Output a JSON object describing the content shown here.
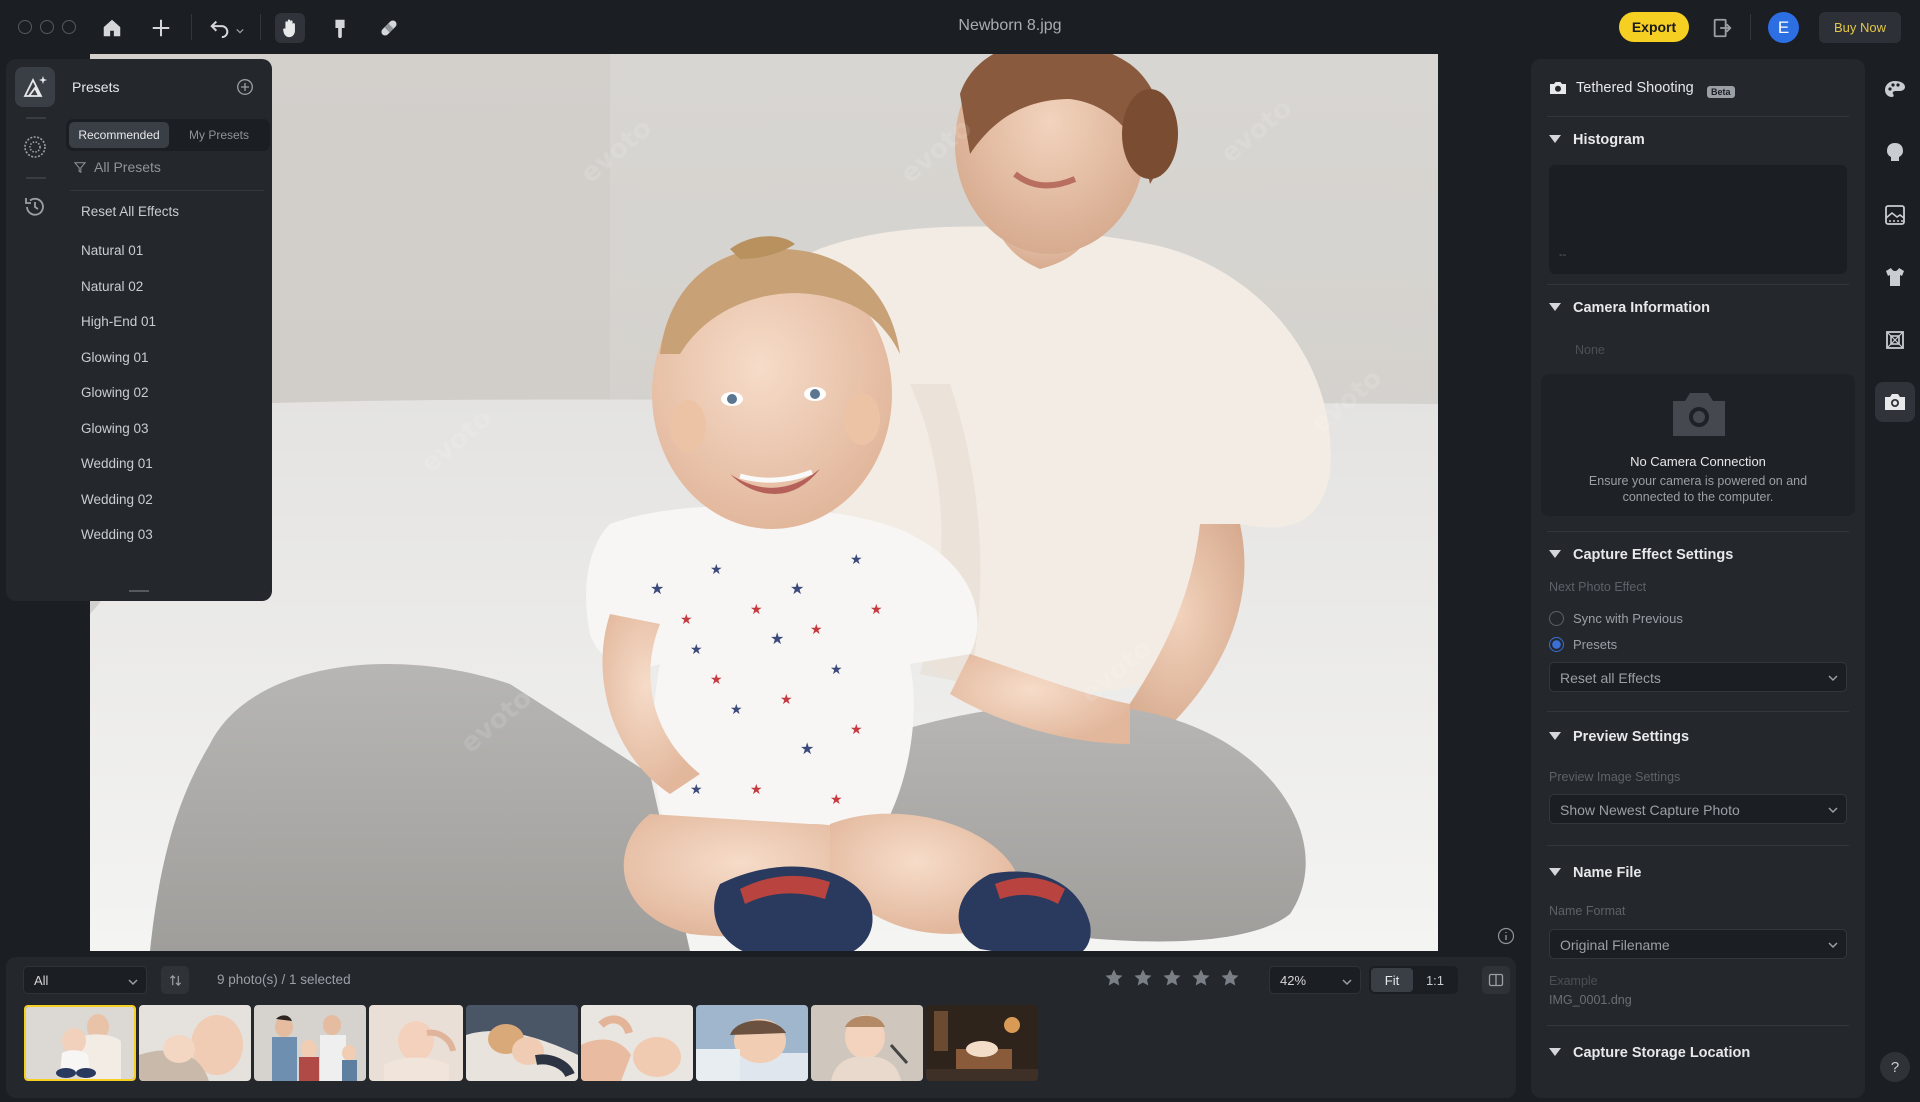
{
  "window": {
    "title": "Newborn 8.jpg"
  },
  "toolbar": {
    "icons": [
      "home-icon",
      "plus-icon",
      "undo-icon",
      "hand-icon",
      "brush-icon",
      "bandage-icon",
      "export-to-icon"
    ],
    "export_label": "Export",
    "user_initial": "E",
    "buy_label": "Buy Now"
  },
  "presets": {
    "title": "Presets",
    "tabs": [
      "Recommended",
      "My Presets"
    ],
    "filter_label": "All Presets",
    "items": [
      "Reset All Effects",
      "Natural 01",
      "Natural 02",
      "High-End 01",
      "Glowing 01",
      "Glowing 02",
      "Glowing 03",
      "Wedding 01",
      "Wedding 02",
      "Wedding 03"
    ]
  },
  "bottom": {
    "filter_value": "All",
    "count_text": "9 photo(s) / 1 selected",
    "zoom_value": "42%",
    "fit_label": "Fit",
    "one_to_one_label": "1:1",
    "star_rating": 0
  },
  "right_panel": {
    "tethered_title": "Tethered Shooting",
    "beta_badge": "Beta",
    "histogram_title": "Histogram",
    "histogram_value": "--",
    "camera_info_title": "Camera Information",
    "camera_info_value": "None",
    "no_camera_title": "No Camera Connection",
    "no_camera_desc": "Ensure your camera is powered on and connected to the computer.",
    "capture_title": "Capture Effect Settings",
    "next_photo_label": "Next Photo Effect",
    "radio_sync": "Sync with Previous",
    "radio_presets": "Presets",
    "effect_select": "Reset all Effects",
    "preview_title": "Preview Settings",
    "preview_label": "Preview Image Settings",
    "preview_select": "Show Newest Capture Photo",
    "name_file_title": "Name File",
    "name_format_label": "Name Format",
    "name_format_select": "Original Filename",
    "example_label": "Example",
    "example_value": "IMG_0001.dng",
    "storage_title": "Capture Storage Location"
  },
  "help_label": "?",
  "colors": {
    "accent": "#f5cf22",
    "avatar": "#2b6fe3",
    "radio_selected": "#3a6fd8",
    "panel": "#24282d",
    "background": "#1b1e22"
  }
}
